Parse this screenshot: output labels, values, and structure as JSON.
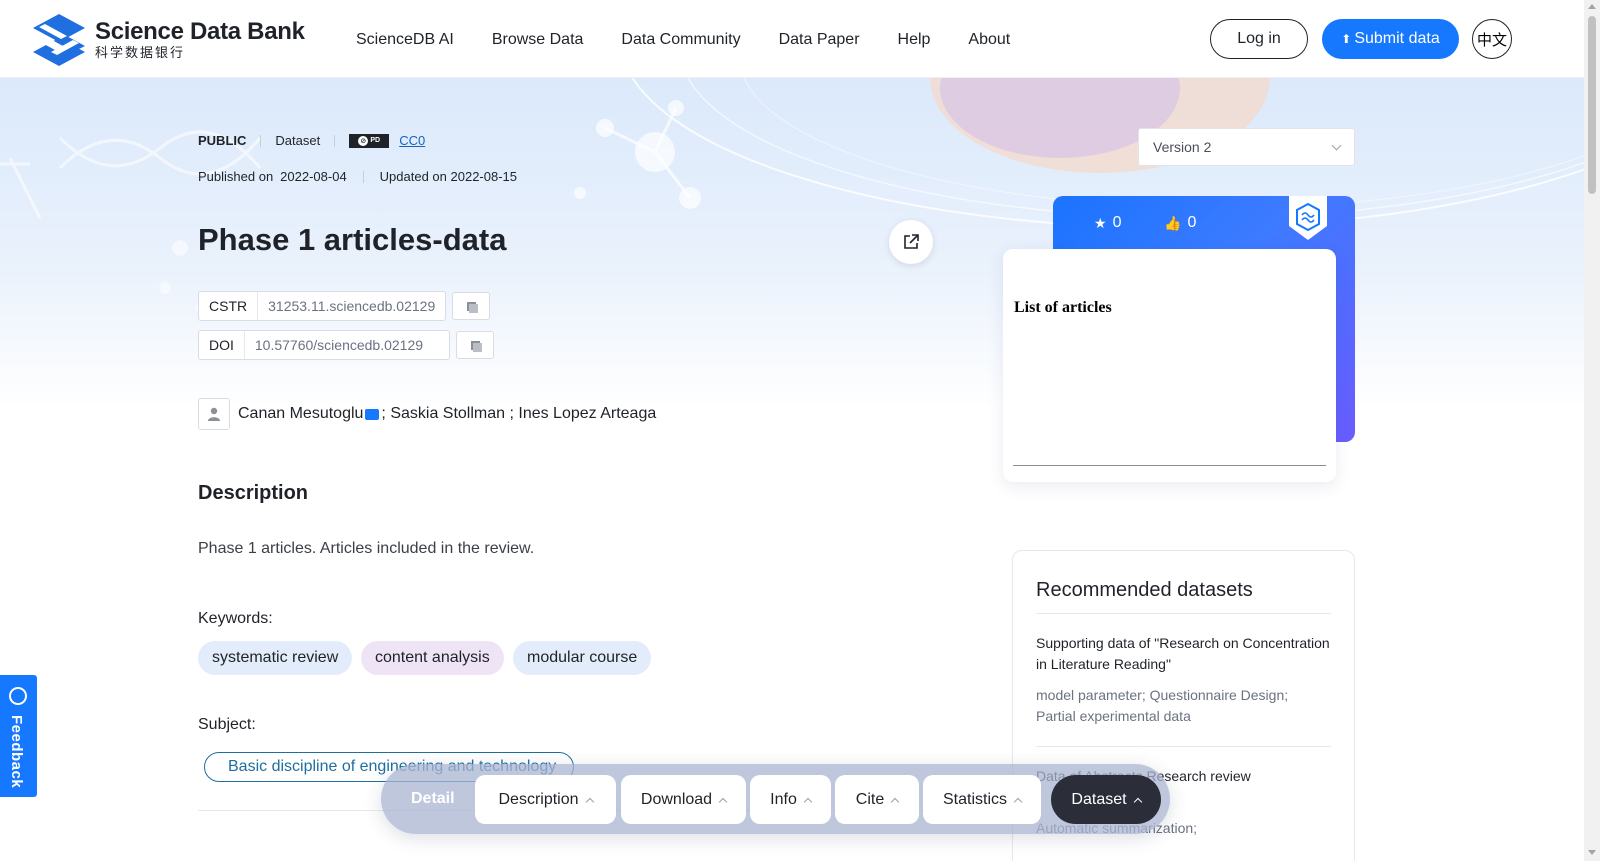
{
  "header": {
    "logo_en": "Science Data Bank",
    "logo_cn": "科学数据银行",
    "nav": [
      "ScienceDB AI",
      "Browse Data",
      "Data Community",
      "Data Paper",
      "Help",
      "About"
    ],
    "login_label": "Log in",
    "submit_label": "Submit data",
    "lang_label": "中文"
  },
  "dataset": {
    "visibility": "PUBLIC",
    "type": "Dataset",
    "license": "CC0",
    "published_label": "Published on",
    "published_date": "2022-08-04",
    "updated": "Updated on 2022-08-15",
    "title": "Phase 1 articles-data",
    "cstr_key": "CSTR",
    "cstr_value": "31253.11.sciencedb.02129",
    "doi_key": "DOI",
    "doi_value": "10.57760/sciencedb.02129",
    "author_first": "Canan Mesutoglu",
    "authors_rest": "; Saskia Stollman ; Ines Lopez Arteaga"
  },
  "description": {
    "heading": "Description",
    "text": "Phase 1 articles. Articles included in the review.",
    "keywords_label": "Keywords:",
    "keywords": [
      "systematic review",
      "content analysis",
      "modular course"
    ],
    "subject_label": "Subject:",
    "subject": "Basic discipline of engineering and technology"
  },
  "sidebar": {
    "version": "Version 2",
    "stars": "0",
    "likes": "0",
    "preview_title": "List of articles",
    "recommended_title": "Recommended datasets",
    "recommended": [
      {
        "title": "Supporting data of \"Research on Concentration in Literature Reading\"",
        "keywords": "model parameter; Questionnaire Design; Partial experimental data"
      },
      {
        "title": "Data of Abstracts Research review",
        "keywords": "Automatic summarization;"
      }
    ]
  },
  "feedback_label": "Feedback",
  "tabs": {
    "detail": "Detail",
    "items": [
      "Description",
      "Download",
      "Info",
      "Cite",
      "Statistics",
      "Dataset"
    ]
  },
  "colors": {
    "primary": "#1677ff",
    "dark_tab": "#2b2e38",
    "subject_tag": "#1e6f9f"
  }
}
